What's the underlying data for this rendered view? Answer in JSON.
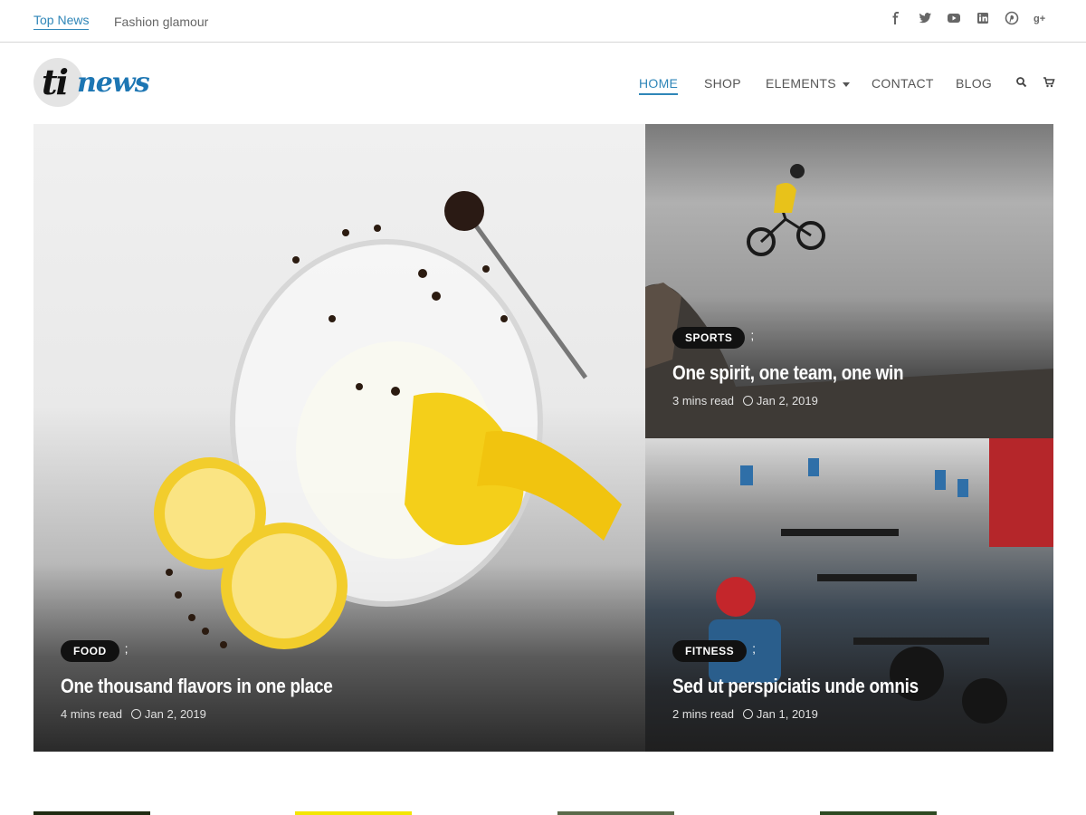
{
  "topbar": {
    "link1": "Top News",
    "link2": "Fashion glamour",
    "social": [
      {
        "icon": "facebook-icon",
        "glyph": "f"
      },
      {
        "icon": "twitter-icon",
        "glyph": "t"
      },
      {
        "icon": "youtube-icon",
        "glyph": "▶"
      },
      {
        "icon": "linkedin-icon",
        "glyph": "in"
      },
      {
        "icon": "pinterest-icon",
        "glyph": "p"
      },
      {
        "icon": "google-plus-icon",
        "glyph": "g+"
      }
    ]
  },
  "header": {
    "logo_text_1": "ti",
    "logo_text_2": "news",
    "nav": {
      "home": "HOME",
      "shop": "SHOP",
      "elements": "ELEMENTS",
      "contact": "CONTACT",
      "blog": "BLOG"
    },
    "search_icon": "search-icon",
    "cart_icon": "cart-icon"
  },
  "hero": {
    "food": {
      "badge": "FOOD",
      "semi": ";",
      "title": "One thousand flavors in one place",
      "read": "4 mins read",
      "date": "Jan 2, 2019"
    },
    "sports": {
      "badge": "SPORTS",
      "semi": ";",
      "title": "One spirit, one team, one win",
      "read": "3 mins read",
      "date": "Jan 2, 2019"
    },
    "fitness": {
      "badge": "FITNESS",
      "semi": ";",
      "title": "Sed ut perspiciatis unde omnis",
      "read": "2 mins read",
      "date": "Jan 1, 2019"
    }
  },
  "colors": {
    "accent": "#2f86b8",
    "logo_blue": "#1d76b3",
    "badge_bg": "#111111"
  }
}
